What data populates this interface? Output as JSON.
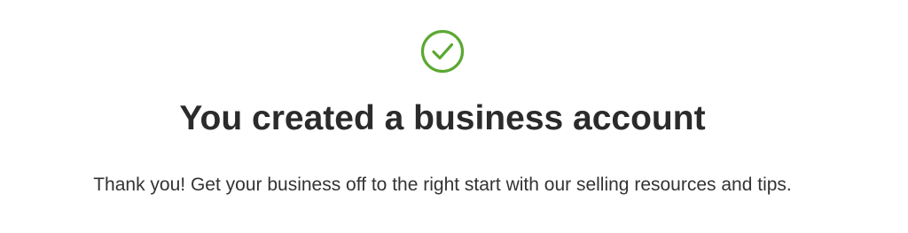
{
  "confirmation": {
    "icon": "check-circle-icon",
    "title": "You created a business account",
    "message": "Thank you! Get your business off to the right start with our selling resources and tips."
  },
  "colors": {
    "success_green": "#5ba832",
    "title_text": "#2b2b2b",
    "body_text": "#333333",
    "background": "#ffffff"
  }
}
